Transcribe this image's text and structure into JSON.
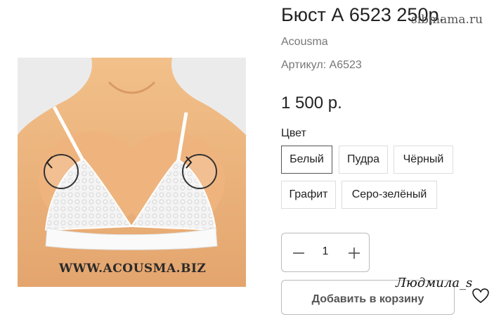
{
  "product": {
    "title": "Бюст А 6523 250р.",
    "brand": "Acousma",
    "sku": "Артикул: А6523",
    "price": "1 500 р.",
    "color_label": "Цвет",
    "colors": [
      "Белый",
      "Пудра",
      "Чёрный",
      "Графит",
      "Серо-зелёный"
    ],
    "selected_color": "Белый",
    "quantity": "1",
    "add_to_cart": "Добавить в корзину"
  },
  "gallery": {
    "prev_icon": "chevron-left-icon",
    "next_icon": "chevron-right-icon",
    "image_watermark": "WWW.ACOUSMA.BIZ"
  },
  "overlays": {
    "site_watermark": "sibmama.ru",
    "signature": "Людмила_s",
    "signature_icon": "heart-outline-icon"
  }
}
